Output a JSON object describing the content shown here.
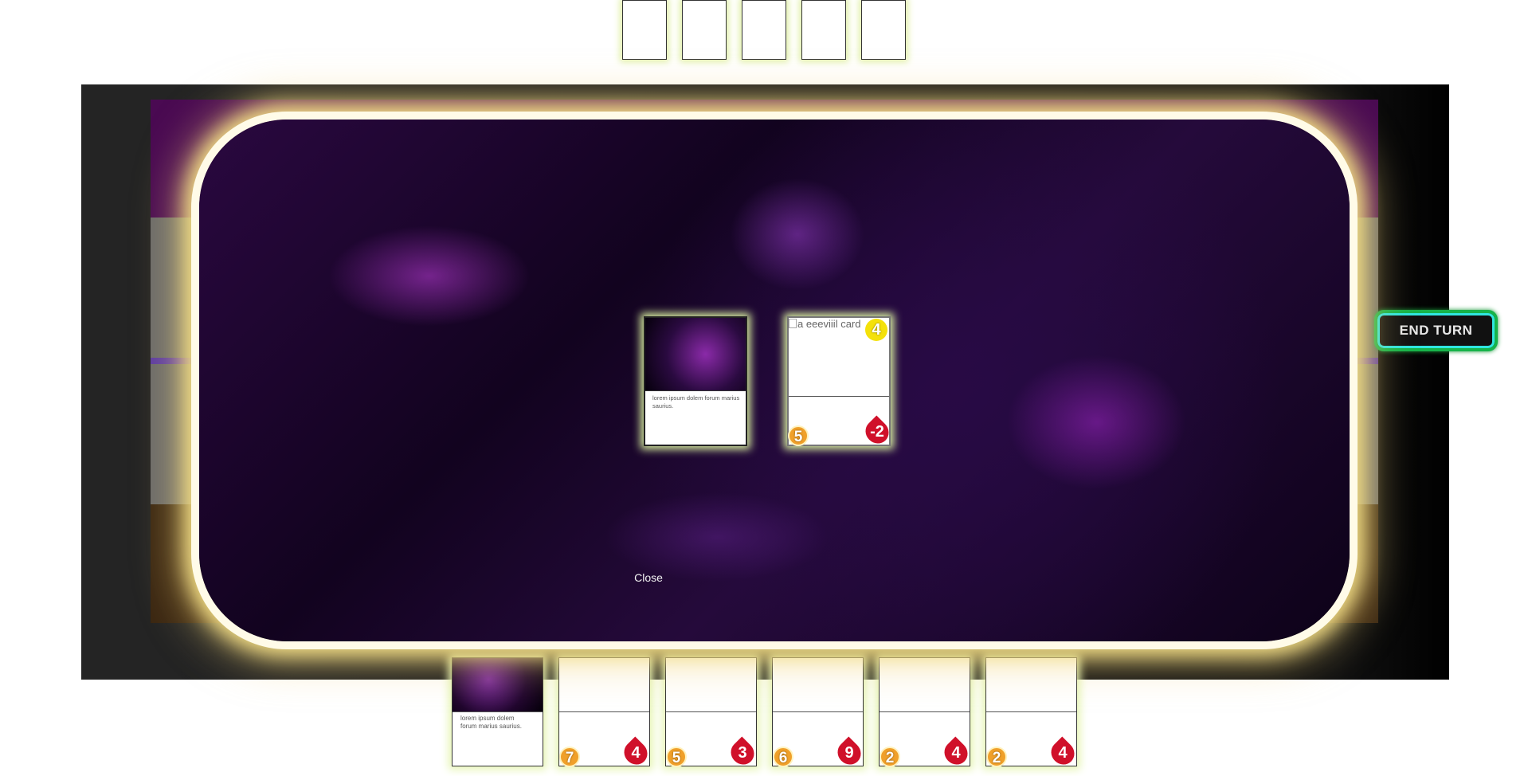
{
  "opponent_hand": {
    "count": 5
  },
  "end_turn": {
    "label": "END TURN"
  },
  "modal": {
    "cards": [
      {
        "text": "lorem ipsum dolem forum marius saurius."
      },
      {
        "alt_text": "a eeeviiil card",
        "attack": "4",
        "cost": "5",
        "health": "-2"
      }
    ],
    "close_label": "Close"
  },
  "hand": {
    "cards": [
      {
        "text": "lorem ipsum dolem forum marius saurius."
      },
      {
        "cost": "7",
        "health": "4"
      },
      {
        "cost": "5",
        "health": "3"
      },
      {
        "cost": "6",
        "health": "9"
      },
      {
        "cost": "2",
        "health": "4"
      },
      {
        "cost": "2",
        "health": "4"
      }
    ]
  },
  "colors": {
    "cost": "#f0a02a",
    "health": "#d0102a",
    "attack": "#f4e10a",
    "end_turn_border": "#17b34a",
    "modal_glow": "#f3de86"
  }
}
